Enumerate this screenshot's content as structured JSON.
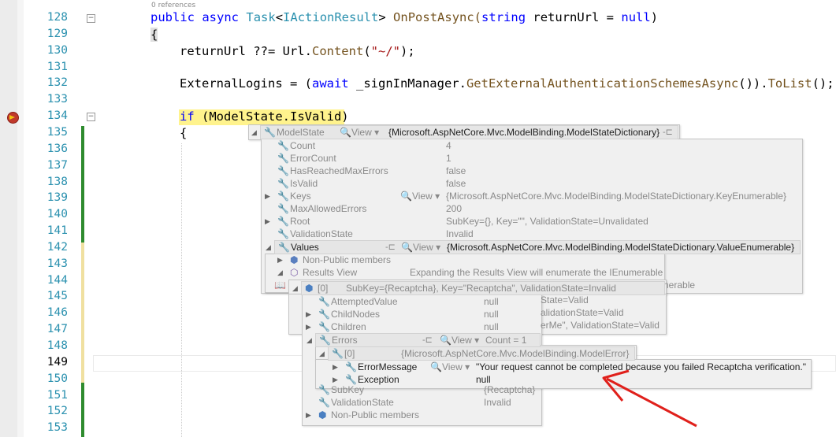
{
  "line_numbers": [
    "128",
    "129",
    "130",
    "131",
    "132",
    "133",
    "134",
    "135",
    "136",
    "137",
    "138",
    "139",
    "140",
    "141",
    "142",
    "143",
    "144",
    "145",
    "146",
    "147",
    "148",
    "149",
    "150",
    "151",
    "152",
    "153"
  ],
  "current_line": "149",
  "reference_hint": "0 references",
  "code": {
    "l128": {
      "kw1": "public",
      "kw2": "async",
      "type": "Task",
      "lt": "<",
      "iface": "IActionResult",
      "gt": ">",
      "method": " OnPostAsync(",
      "kw3": "string",
      "param": " returnUrl = ",
      "kw4": "null",
      ")": ")"
    },
    "l129": "{",
    "l130": {
      "a": "returnUrl ??= Url.",
      "method": "Content",
      "b": "(",
      "str": "\"~/\"",
      "c": ");"
    },
    "l132": {
      "a": "ExternalLogins = (",
      "kw": "await",
      "b": " _signInManager.",
      "method": "GetExternalAuthenticationSchemesAsync",
      "c": "()).",
      "method2": "ToList",
      "d": "();"
    },
    "l134": {
      "kw": "if",
      "a": " (ModelState.IsValid)"
    },
    "l135": "{"
  },
  "datatips": {
    "root": {
      "name": "ModelState",
      "view": "View",
      "value": "{Microsoft.AspNetCore.Mvc.ModelBinding.ModelStateDictionary}"
    },
    "props": [
      {
        "name": "Count",
        "value": "4"
      },
      {
        "name": "ErrorCount",
        "value": "1"
      },
      {
        "name": "HasReachedMaxErrors",
        "value": "false"
      },
      {
        "name": "IsValid",
        "value": "false"
      },
      {
        "name": "Keys",
        "view": "View",
        "value": "{Microsoft.AspNetCore.Mvc.ModelBinding.ModelStateDictionary.KeyEnumerable}"
      },
      {
        "name": "MaxAllowedErrors",
        "value": "200"
      },
      {
        "name": "Root",
        "value": "SubKey={}, Key=\"\", ValidationState=Unvalidated"
      },
      {
        "name": "ValidationState",
        "value": "Invalid"
      },
      {
        "name": "Values",
        "view": "View",
        "value": "{Microsoft.AspNetCore.Mvc.ModelBinding.ModelStateDictionary.ValueEnumerable}"
      }
    ],
    "values": {
      "non_public": "Non-Public members",
      "results_view": "Results View",
      "results_hint": "Expanding the Results View will enumerate the IEnumerable",
      "partial_right": "nerable"
    },
    "item0": {
      "index": "[0]",
      "value": "SubKey={Recaptcha}, Key=\"Recaptcha\", ValidationState=Invalid"
    },
    "item0_props": [
      {
        "name": "AttemptedValue",
        "value": "null"
      },
      {
        "name": "ChildNodes",
        "value": "null"
      },
      {
        "name": "Children",
        "value": "null"
      },
      {
        "name": "Errors",
        "view": "View",
        "value": "Count = 1"
      }
    ],
    "behind_right": [
      "State=Valid",
      "alidationState=Valid",
      "erMe\", ValidationState=Valid"
    ],
    "error0": {
      "index": "[0]",
      "value": "{Microsoft.AspNetCore.Mvc.ModelBinding.ModelError}"
    },
    "error_props": [
      {
        "name": "ErrorMessage",
        "view": "View",
        "value": "\"Your request cannot be completed because you failed Recaptcha verification.\""
      },
      {
        "name": "Exception",
        "value": "null"
      }
    ],
    "tail": [
      {
        "name": "SubKey",
        "value": "{Recaptcha}"
      },
      {
        "name": "ValidationState",
        "value": "Invalid"
      },
      {
        "name": "Non-Public members",
        "value": ""
      }
    ]
  },
  "colors": {
    "keyword": "#0000ff",
    "type": "#2b91af",
    "string": "#a31515",
    "highlight": "#fff38d",
    "arrow": "#e0201b",
    "change_saved": "#2e8b2e",
    "change_unsaved": "#f0e0a0"
  }
}
